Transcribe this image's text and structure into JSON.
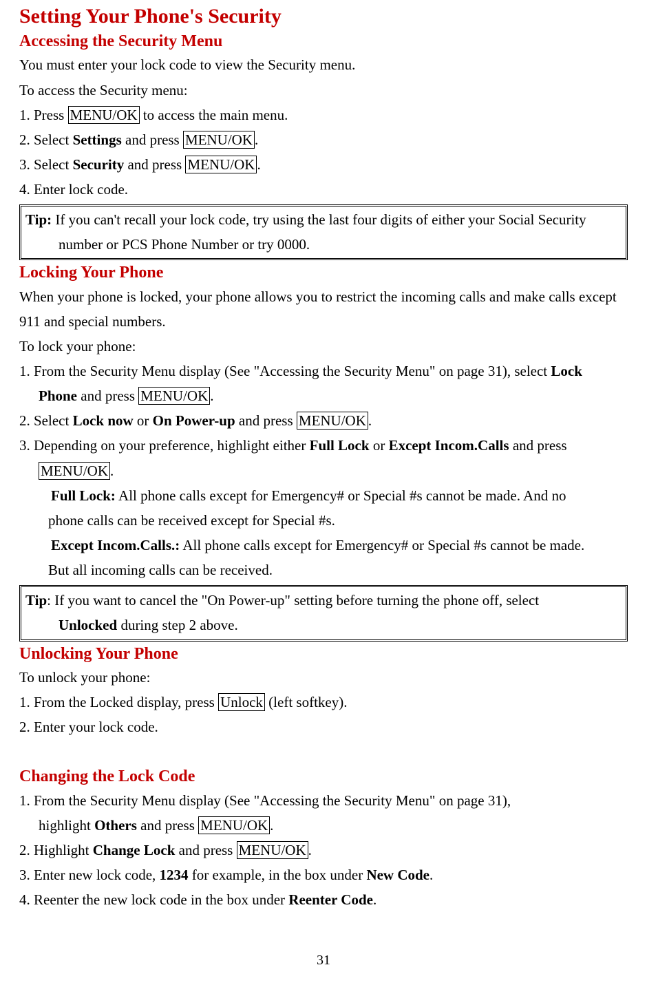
{
  "title": "Setting Your Phone's Security",
  "s1": {
    "heading": "Accessing the Security Menu",
    "p1": "You must enter your lock code to view the Security menu.",
    "p2": "To access the Security menu:",
    "l1a": "1. Press ",
    "l1key": "MENU/OK",
    "l1b": " to access the main menu.",
    "l2a": "2. Select ",
    "l2bold": "Settings",
    "l2b": " and press ",
    "l2key": "MENU/OK",
    "l2c": ".",
    "l3a": "3. Select ",
    "l3bold": "Security",
    "l3b": " and press ",
    "l3key": "MENU/OK",
    "l3c": ".",
    "l4": "4. Enter lock code.",
    "tip_label": "Tip:",
    "tip_a": " If you can't recall your lock code, try using the last four digits of either your Social Security",
    "tip_b": "number or PCS Phone Number or try 0000."
  },
  "s2": {
    "heading": "Locking Your Phone",
    "p1": "When your phone is locked, your phone allows you to restrict the incoming calls and make calls except 911 and special numbers.",
    "p2": "To lock your phone:",
    "l1a": "1. From the Security Menu display (See \"Accessing the Security Menu\" on page 31), select ",
    "l1bold": "Lock",
    "l1cont_bold": "Phone",
    "l1cont_a": " and press ",
    "l1cont_key": "MENU/OK",
    "l1cont_b": ".",
    "l2a": "2. Select ",
    "l2bold1": "Lock now",
    "l2mid": " or ",
    "l2bold2": "On Power-up",
    "l2b": " and press ",
    "l2key": "MENU/OK",
    "l2c": ".",
    "l3a": "3. Depending on your preference, highlight either ",
    "l3bold1": "Full Lock",
    "l3mid": " or ",
    "l3bold2": "Except Incom.Calls",
    "l3b": " and press",
    "l3cont_key": "MENU/OK",
    "l3cont_b": ".",
    "b1_bold": "Full Lock:",
    "b1_a": " All phone calls except for Emergency# or Special #s cannot be made. And no",
    "b1_cont": "phone calls can be received except for Special #s.",
    "b2_bold": "Except Incom.Calls.:",
    "b2_a": " All phone calls except for Emergency# or Special #s cannot be made.",
    "b2_cont": "But all incoming calls can be received.",
    "tip_label": "Tip",
    "tip_a": ": If you want to cancel the \"On Power-up\" setting before turning the phone off, select",
    "tip_b_bold": "Unlocked",
    "tip_b_rest": " during step 2 above."
  },
  "s3": {
    "heading": "Unlocking Your Phone",
    "p1": "To unlock your phone:",
    "l1a": "1. From the Locked display, press ",
    "l1key": "Unlock",
    "l1b": " (left softkey).",
    "l2": "2. Enter your lock code."
  },
  "s4": {
    "heading": "Changing the Lock Code",
    "l1a": "1. From the Security Menu display (See \"Accessing the Security Menu\" on page 31),",
    "l1cont_a": "highlight ",
    "l1cont_bold": "Others",
    "l1cont_b": " and press ",
    "l1cont_key": "MENU/OK",
    "l1cont_c": ".",
    "l2a": "2. Highlight ",
    "l2bold": "Change Lock",
    "l2b": " and press ",
    "l2key": "MENU/OK",
    "l2c": ".",
    "l3a": "3. Enter new lock code, ",
    "l3bold1": "1234",
    "l3b": " for example, in the box under ",
    "l3bold2": "New Code",
    "l3c": ".",
    "l4a": "4. Reenter the new lock code in the box under ",
    "l4bold": "Reenter Code",
    "l4b": "."
  },
  "page_number": "31"
}
